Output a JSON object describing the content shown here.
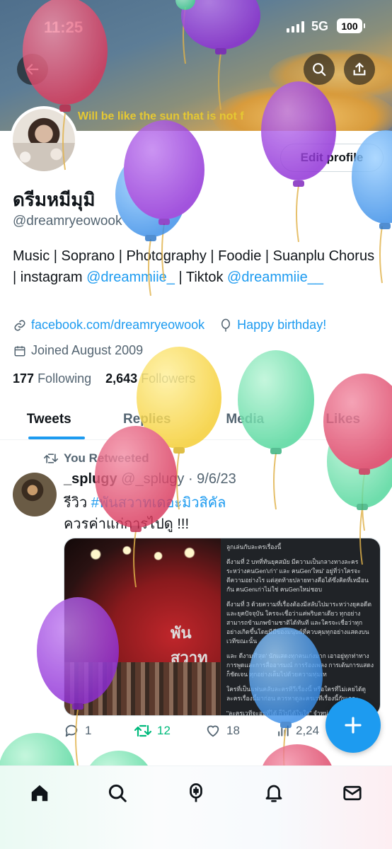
{
  "status_bar": {
    "time": "11:25",
    "network": "5G",
    "battery": "100"
  },
  "banner": {
    "quote": "Will be like the sun that is not f"
  },
  "profile": {
    "edit_label": "Edit profile",
    "name": "ดรีมหมีมุมิ",
    "handle": "@dreamryeowook",
    "bio_text_1": "Music | Soprano | Photography | Foodie | Suanplu Chorus | instagram ",
    "bio_link_1": "@dreammiie_",
    "bio_text_2": " | Tiktok ",
    "bio_link_2": "@dreammiie__",
    "website": "facebook.com/dreamryeowook",
    "birthday": "Happy birthday!",
    "joined": "Joined August 2009",
    "following_count": "177",
    "following_label": "Following",
    "followers_count": "2,643",
    "followers_label": "Followers"
  },
  "tabs": [
    {
      "label": "Tweets"
    },
    {
      "label": "Replies"
    },
    {
      "label": "Media"
    },
    {
      "label": "Likes"
    }
  ],
  "tweet": {
    "retweet_label": "You Retweeted",
    "author": "_splugy",
    "handle": "@_splugy",
    "date": "· 9/6/23",
    "text_1_prefix": "รีวิว ",
    "text_1_hashtag": "#พันสวาทเดอะมิวสิคัล",
    "text_2": "ควรค่าแก่การไปดู !!!",
    "media_sign": "พันสวาท",
    "media_paragraphs": [
      "ลูกเล่นกับละครเรื่องนี้",
      "ดีงามที่ 2 บทที่ทันยุคสมัย มีความเป็นกลางทางละคร ระหว่างคนGen'เก่า' และ คนGen'ใหม่' อยู่ที่ว่าใครจะตีความอย่างไร แต่สุดท้ายปลายทางคือได้ซึ่งคิดที่เหมือนกัน คนGenเก่าไม่ใช่ คนGenใหม่ชอบ",
      "ดีงามที่ 3 ด้วยความที่เรื่องต้องมีสลับไปมาระหว่างยุคอดีตและยุคปัจจุบัน ใครจะเชื่อว่าแค่พริบตาเดียว ทุกอย่างสามารถข้ามภพข้ามชาติได้ทันที และใครจะเชื่อว่าทุกอย่างเกิดขึ้นโดยมีมีของมนุษย์ที่ควบคุมทุกอย่างแสดงบนเวทีขณะนั้น",
      "และ ดีงามที่'สุด' นักแสดงทุกคนเก่งมาก เอาอยู่ทุกท่าทาง การพูดและการสื่ออารมณ์ การร้องเพลง การเต้นการแสดงก็ชัดเจน ทุกอย่างเต็มไปด้วยความทุ่มเท",
      "ใครที่เป็นแฟนคลับละครทีวีเรื่องนี้ หรือใครที่ไม่เคยได้ดูละครเรื่องนี้มาก่อน ควรหาดูละครเวทีเรื่องนี้กันเถอะ",
      "\"ละครเวทีจะอยู่ที่ได้ ก็ไปได้ในใจ\" จำหน่ายบัตรแล้วที่ ThaiTicketMajor"
    ],
    "replies": "1",
    "retweets": "12",
    "likes": "18",
    "views": "2,24"
  },
  "colors": {
    "accent": "#1d9bf0",
    "retweet": "#00ba7c",
    "banner_quote": "#e5c833"
  },
  "icons": {
    "back": "back-arrow-icon",
    "search": "search-icon",
    "share": "share-icon",
    "link": "link-icon",
    "birthday": "balloon-icon",
    "calendar": "calendar-icon",
    "retweet": "retweet-icon",
    "reply": "reply-icon",
    "like": "heart-icon",
    "views": "views-icon",
    "compose": "plus-icon",
    "home": "home-icon",
    "explore": "search-icon",
    "spaces": "microphone-icon",
    "notifications": "bell-icon",
    "messages": "envelope-icon"
  }
}
